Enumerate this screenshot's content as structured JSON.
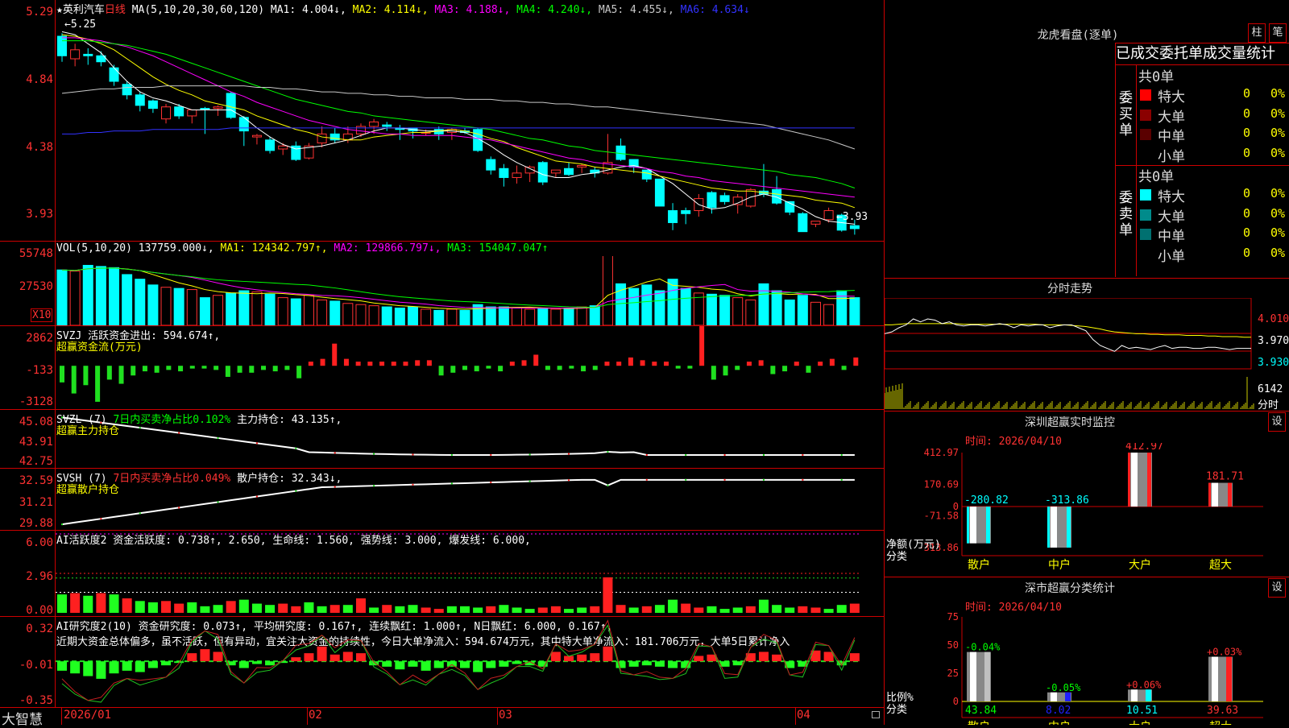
{
  "colors": {
    "up": "#ff3232",
    "down": "#00ffff",
    "ma1": "#ffffff",
    "ma2": "#ffff00",
    "ma3": "#ff00ff",
    "ma4": "#00ff00",
    "ma5": "#c8c8c8",
    "ma6": "#3232ff",
    "grid": "#cc0000"
  },
  "header": {
    "star": "★",
    "stock_name": "英利汽车",
    "period": "日线",
    "ma_params": "MA(5,10,20,30,60,120)",
    "ma1": "MA1: 4.004↓,",
    "ma2": "MA2: 4.114↓,",
    "ma3": "MA3: 4.188↓,",
    "ma4": "MA4: 4.240↓,",
    "ma5": "MA5: 4.455↓,",
    "ma6": "MA6: 4.634↓"
  },
  "price_panel": {
    "y_ticks": [
      "5.29",
      "4.84",
      "4.38",
      "3.93"
    ],
    "high_label": "←5.25",
    "low_label": "←3.93",
    "y_range": [
      3.9,
      5.4
    ]
  },
  "candles": [
    [
      5.25,
      5.12,
      5.27,
      5.08
    ],
    [
      5.1,
      5.16,
      5.2,
      5.05
    ],
    [
      5.13,
      5.12,
      5.17,
      5.06
    ],
    [
      5.12,
      5.08,
      5.15,
      5.05
    ],
    [
      5.04,
      4.95,
      5.06,
      4.92
    ],
    [
      4.93,
      4.86,
      4.95,
      4.83
    ],
    [
      4.86,
      4.79,
      4.88,
      4.75
    ],
    [
      4.82,
      4.77,
      4.83,
      4.74
    ],
    [
      4.7,
      4.78,
      4.8,
      4.67
    ],
    [
      4.78,
      4.72,
      4.8,
      4.7
    ],
    [
      4.72,
      4.76,
      4.76,
      4.67
    ],
    [
      4.77,
      4.76,
      4.78,
      4.6
    ],
    [
      4.77,
      4.78,
      4.79,
      4.72
    ],
    [
      4.87,
      4.71,
      4.88,
      4.7
    ],
    [
      4.71,
      4.62,
      4.72,
      4.52
    ],
    [
      4.58,
      4.59,
      4.6,
      4.53
    ],
    [
      4.56,
      4.49,
      4.58,
      4.47
    ],
    [
      4.5,
      4.52,
      4.54,
      4.46
    ],
    [
      4.52,
      4.43,
      4.55,
      4.42
    ],
    [
      4.44,
      4.52,
      4.54,
      4.43
    ],
    [
      4.54,
      4.6,
      4.65,
      4.51
    ],
    [
      4.6,
      4.56,
      4.64,
      4.54
    ],
    [
      4.56,
      4.6,
      4.65,
      4.54
    ],
    [
      4.6,
      4.65,
      4.67,
      4.58
    ],
    [
      4.65,
      4.68,
      4.7,
      4.6
    ],
    [
      4.66,
      4.65,
      4.68,
      4.62
    ],
    [
      4.64,
      4.63,
      4.66,
      4.56
    ],
    [
      4.64,
      4.62,
      4.64,
      4.57
    ],
    [
      4.61,
      4.61,
      4.63,
      4.59
    ],
    [
      4.63,
      4.6,
      4.65,
      4.56
    ],
    [
      4.61,
      4.63,
      4.64,
      4.56
    ],
    [
      4.62,
      4.61,
      4.64,
      4.6
    ],
    [
      4.63,
      4.49,
      4.64,
      4.48
    ],
    [
      4.43,
      4.36,
      4.45,
      4.33
    ],
    [
      4.37,
      4.31,
      4.4,
      4.25
    ],
    [
      4.31,
      4.34,
      4.39,
      4.27
    ],
    [
      4.34,
      4.38,
      4.39,
      4.28
    ],
    [
      4.41,
      4.28,
      4.42,
      4.26
    ],
    [
      4.34,
      4.36,
      4.36,
      4.31
    ],
    [
      4.37,
      4.33,
      4.41,
      4.32
    ],
    [
      4.38,
      4.39,
      4.4,
      4.34
    ],
    [
      4.36,
      4.34,
      4.38,
      4.31
    ],
    [
      4.34,
      4.41,
      4.6,
      4.33
    ],
    [
      4.52,
      4.43,
      4.57,
      4.42
    ],
    [
      4.43,
      4.38,
      4.43,
      4.34
    ],
    [
      4.36,
      4.3,
      4.36,
      4.28
    ],
    [
      4.3,
      4.12,
      4.3,
      4.12
    ],
    [
      4.09,
      4.01,
      4.14,
      3.96
    ],
    [
      4.09,
      4.07,
      4.11,
      4.0
    ],
    [
      4.09,
      4.17,
      4.2,
      4.05
    ],
    [
      4.21,
      4.11,
      4.22,
      4.07
    ],
    [
      4.19,
      4.15,
      4.21,
      4.13
    ],
    [
      4.13,
      4.18,
      4.2,
      4.07
    ],
    [
      4.12,
      4.23,
      4.24,
      4.11
    ],
    [
      4.22,
      4.2,
      4.4,
      4.18
    ],
    [
      4.23,
      4.14,
      4.32,
      4.13
    ],
    [
      4.15,
      4.08,
      4.15,
      4.06
    ],
    [
      4.07,
      3.95,
      4.08,
      3.95
    ],
    [
      4.0,
      4.02,
      4.02,
      3.98
    ],
    [
      4.03,
      4.09,
      4.11,
      4.01
    ],
    [
      4.06,
      3.96,
      4.07,
      3.95
    ],
    [
      3.99,
      3.97,
      4.03,
      3.93
    ]
  ],
  "ma_lines": {
    "ma1": [
      5.28,
      5.26,
      5.2,
      5.14,
      5.04,
      4.95,
      4.88,
      4.84,
      4.82,
      4.79,
      4.76,
      4.76,
      4.76,
      4.76,
      4.71,
      4.64,
      4.58,
      4.53,
      4.5,
      4.51,
      4.52,
      4.54,
      4.56,
      4.59,
      4.62,
      4.64,
      4.64,
      4.63,
      4.62,
      4.62,
      4.62,
      4.61,
      4.57,
      4.52,
      4.46,
      4.41,
      4.37,
      4.33,
      4.31,
      4.31,
      4.33,
      4.34,
      4.36,
      4.38,
      4.39,
      4.37,
      4.32,
      4.27,
      4.2,
      4.13,
      4.1,
      4.11,
      4.14,
      4.18,
      4.2,
      4.18,
      4.14,
      4.1,
      4.05,
      4.02,
      4.01,
      4.0
    ],
    "ma2": [
      5.26,
      5.25,
      5.23,
      5.2,
      5.16,
      5.1,
      5.04,
      4.98,
      4.93,
      4.89,
      4.86,
      4.82,
      4.8,
      4.78,
      4.76,
      4.72,
      4.69,
      4.66,
      4.63,
      4.61,
      4.58,
      4.57,
      4.56,
      4.56,
      4.58,
      4.59,
      4.6,
      4.61,
      4.61,
      4.62,
      4.63,
      4.62,
      4.6,
      4.57,
      4.55,
      4.51,
      4.48,
      4.45,
      4.42,
      4.41,
      4.4,
      4.38,
      4.37,
      4.36,
      4.35,
      4.34,
      4.32,
      4.3,
      4.28,
      4.26,
      4.24,
      4.23,
      4.22,
      4.22,
      4.21,
      4.2,
      4.19,
      4.18,
      4.16,
      4.15,
      4.14,
      4.11
    ],
    "ma3": [
      5.24,
      5.24,
      5.23,
      5.22,
      5.2,
      5.18,
      5.15,
      5.12,
      5.08,
      5.04,
      5.0,
      4.96,
      4.92,
      4.88,
      4.85,
      4.81,
      4.78,
      4.75,
      4.72,
      4.69,
      4.67,
      4.65,
      4.63,
      4.62,
      4.61,
      4.6,
      4.6,
      4.59,
      4.59,
      4.59,
      4.59,
      4.58,
      4.57,
      4.56,
      4.54,
      4.52,
      4.5,
      4.48,
      4.46,
      4.44,
      4.43,
      4.41,
      4.4,
      4.39,
      4.38,
      4.37,
      4.35,
      4.34,
      4.32,
      4.31,
      4.29,
      4.28,
      4.27,
      4.26,
      4.25,
      4.24,
      4.23,
      4.22,
      4.21,
      4.2,
      4.19,
      4.18
    ],
    "ma4": [
      5.22,
      5.22,
      5.22,
      5.21,
      5.2,
      5.19,
      5.17,
      5.15,
      5.13,
      5.1,
      5.07,
      5.04,
      5.01,
      4.98,
      4.95,
      4.92,
      4.89,
      4.86,
      4.83,
      4.81,
      4.79,
      4.77,
      4.75,
      4.74,
      4.72,
      4.71,
      4.7,
      4.69,
      4.68,
      4.67,
      4.66,
      4.65,
      4.64,
      4.63,
      4.61,
      4.59,
      4.57,
      4.56,
      4.54,
      4.52,
      4.51,
      4.49,
      4.48,
      4.47,
      4.46,
      4.45,
      4.44,
      4.43,
      4.42,
      4.41,
      4.4,
      4.39,
      4.38,
      4.37,
      4.36,
      4.35,
      4.33,
      4.32,
      4.31,
      4.29,
      4.27,
      4.24
    ],
    "ma5": [
      4.87,
      4.88,
      4.89,
      4.9,
      4.9,
      4.91,
      4.91,
      4.91,
      4.92,
      4.92,
      4.92,
      4.92,
      4.92,
      4.92,
      4.92,
      4.91,
      4.91,
      4.9,
      4.9,
      4.89,
      4.88,
      4.88,
      4.87,
      4.87,
      4.86,
      4.86,
      4.85,
      4.85,
      4.84,
      4.84,
      4.84,
      4.83,
      4.83,
      4.83,
      4.82,
      4.82,
      4.81,
      4.81,
      4.8,
      4.8,
      4.79,
      4.78,
      4.78,
      4.77,
      4.76,
      4.75,
      4.74,
      4.73,
      4.72,
      4.71,
      4.7,
      4.69,
      4.68,
      4.67,
      4.66,
      4.64,
      4.62,
      4.6,
      4.58,
      4.56,
      4.53,
      4.5
    ],
    "ma6": [
      4.6,
      4.6,
      4.61,
      4.61,
      4.62,
      4.62,
      4.62,
      4.63,
      4.63,
      4.63,
      4.63,
      4.63,
      4.63,
      4.64,
      4.64,
      4.64,
      4.64,
      4.64,
      4.64,
      4.64,
      4.64,
      4.64,
      4.64,
      4.64,
      4.64,
      4.64,
      4.64,
      4.64,
      4.64,
      4.64,
      4.64,
      4.64,
      4.64,
      4.64,
      4.64,
      4.64,
      4.64,
      4.64,
      4.64,
      4.64,
      4.64,
      4.64,
      4.64,
      4.64,
      4.64,
      4.64,
      4.64,
      4.64,
      4.64,
      4.64,
      4.64,
      4.64,
      4.64,
      4.64,
      4.64,
      4.64,
      4.64,
      4.64,
      4.64,
      4.64,
      4.64,
      4.64
    ]
  },
  "vol_panel": {
    "header_param": "VOL(5,10,20)",
    "header_val": "137759.000↓,",
    "ma1": "MA1: 124342.797↑,",
    "ma2": "MA2: 129866.797↓,",
    "ma3": "MA3: 154047.047↑",
    "y_ticks": [
      "55748",
      "27530"
    ],
    "unit": "X10",
    "y_max": 60000,
    "values": [
      48000,
      47000,
      52000,
      51000,
      50000,
      44000,
      40000,
      35000,
      33000,
      32000,
      31000,
      24000,
      26000,
      28000,
      30000,
      29000,
      27000,
      24000,
      23000,
      26000,
      22000,
      21000,
      19000,
      18000,
      17000,
      16000,
      15000,
      16000,
      14000,
      13000,
      14000,
      13000,
      18000,
      16000,
      16000,
      15000,
      14000,
      15000,
      14000,
      15000,
      16000,
      17000,
      68000,
      36000,
      32000,
      35000,
      30000,
      40000,
      32000,
      28000,
      27000,
      26000,
      24000,
      22000,
      36000,
      30000,
      22000,
      26000,
      20000,
      18000,
      30000,
      24000
    ]
  },
  "svzj_panel": {
    "line1": "SVZJ  活跃资金进出: 594.674↑,",
    "line2": "超赢资金流(万元)",
    "y_ticks": [
      "2862",
      "-133",
      "-3128"
    ],
    "y_range": [
      -3128,
      2862
    ],
    "values": [
      -1200,
      -2000,
      -1400,
      -2600,
      -1000,
      -1300,
      -700,
      -400,
      -500,
      -300,
      -400,
      -200,
      -200,
      -300,
      -800,
      -500,
      -500,
      -300,
      -400,
      -300,
      -900,
      300,
      500,
      1600,
      500,
      300,
      300,
      300,
      300,
      300,
      400,
      400,
      -700,
      -500,
      -300,
      -400,
      -200,
      -400,
      300,
      400,
      800,
      -300,
      -300,
      -200,
      -400,
      -300,
      300,
      300,
      600,
      400,
      300,
      300,
      -200,
      -200,
      3000,
      -1000,
      -700,
      -300,
      300,
      400,
      -600,
      -400,
      300,
      -500,
      300,
      500,
      -300,
      600
    ]
  },
  "svzl_panel": {
    "line1_a": "SVZL (7)",
    "line1_b": "7日内买卖净占比0.102%",
    "line1_c": "主力持仓: 43.135↑,",
    "line2": "超赢主力持仓",
    "y_ticks": [
      "45.08",
      "43.91",
      "42.75"
    ],
    "y_range": [
      42.6,
      45.3
    ]
  },
  "svsh_panel": {
    "line1_a": "SVSH (7)",
    "line1_b": "7日内买卖净占比0.049%",
    "line1_c": "散户持仓: 32.343↓,",
    "line2": "超赢散户持仓",
    "y_ticks": [
      "32.59",
      "31.21",
      "29.88"
    ],
    "y_range": [
      29.7,
      33.0
    ]
  },
  "ai_active_panel": {
    "line": "AI活跃度2 资金活跃度: 0.738↑, 2.650, 生命线: 1.560, 强势线: 3.000, 爆发线: 6.000,",
    "y_ticks": [
      "6.00",
      "2.96",
      "0.00"
    ],
    "y_max": 6.0,
    "values": [
      1.4,
      1.5,
      1.3,
      1.5,
      1.4,
      1.1,
      0.9,
      0.8,
      0.9,
      0.7,
      0.8,
      0.5,
      0.6,
      0.9,
      1.0,
      0.7,
      0.6,
      0.7,
      0.5,
      0.8,
      0.5,
      0.6,
      0.6,
      1.1,
      0.4,
      0.6,
      0.5,
      0.6,
      0.4,
      0.3,
      0.5,
      0.5,
      0.4,
      0.5,
      0.6,
      0.4,
      0.3,
      0.4,
      0.5,
      0.3,
      0.4,
      0.5,
      2.7,
      0.6,
      0.4,
      0.5,
      0.6,
      1.0,
      0.7,
      0.4,
      0.5,
      0.3,
      0.4,
      0.5,
      1.0,
      0.6,
      0.4,
      0.5,
      0.4,
      0.3,
      0.6,
      0.7
    ]
  },
  "ai_research_panel": {
    "line": "AI研究度2(10) 资金研究度: 0.073↑, 平均研究度: 0.167↑, 连续飘红: 1.000↑, N日飘红: 6.000, 0.167↑,",
    "comment": "近期大资金总体偏多，虽不活跃，但有异动，宜关注大资金的持续性，今日大单净流入：594.674万元，其中特大单净流入：181.706万元，大单5日累计净入",
    "y_ticks": [
      "0.32",
      "-0.01",
      "-0.35"
    ],
    "y_range": [
      -0.35,
      0.32
    ],
    "values": [
      -0.08,
      -0.1,
      -0.12,
      -0.14,
      -0.1,
      -0.08,
      -0.09,
      -0.06,
      -0.04,
      -0.02,
      0.05,
      0.08,
      0.06,
      -0.04,
      -0.06,
      -0.03,
      -0.04,
      -0.02,
      0.02,
      0.05,
      0.1,
      0.04,
      0.06,
      0.05,
      -0.04,
      -0.05,
      -0.07,
      -0.05,
      -0.08,
      -0.06,
      -0.05,
      -0.06,
      -0.09,
      -0.06,
      -0.05,
      -0.03,
      -0.04,
      -0.05,
      0.06,
      0.03,
      0.04,
      0.05,
      0.1,
      -0.06,
      -0.05,
      -0.04,
      -0.05,
      -0.06,
      -0.06,
      0.03,
      0.04,
      -0.05,
      -0.04,
      0.05,
      0.06,
      0.04,
      -0.06,
      -0.05,
      0.07,
      0.06,
      -0.04,
      0.05
    ]
  },
  "x_axis": {
    "labels": [
      "2026/01",
      "02",
      "03",
      "04"
    ]
  },
  "bottom": {
    "brand": "大智慧"
  },
  "dragon": {
    "title": "龙虎看盘(逐单)",
    "btn_bar": "柱",
    "btn_detail": "笔",
    "header": "已成交委托单成交量统计",
    "buy_total": "共0单",
    "sell_total": "共0单",
    "buy_label": [
      "委",
      "买",
      "单"
    ],
    "sell_label": [
      "委",
      "卖",
      "单"
    ],
    "buy_rows": [
      {
        "name": "特大",
        "count": "0",
        "pct": "0%",
        "color": "#ff0000"
      },
      {
        "name": "大单",
        "count": "0",
        "pct": "0%",
        "color": "#8b0000"
      },
      {
        "name": "中单",
        "count": "0",
        "pct": "0%",
        "color": "#5a0000"
      },
      {
        "name": "小单",
        "count": "0",
        "pct": "0%",
        "color": "#000000"
      }
    ],
    "sell_rows": [
      {
        "name": "特大",
        "count": "0",
        "pct": "0%",
        "color": "#00ffff"
      },
      {
        "name": "大单",
        "count": "0",
        "pct": "0%",
        "color": "#008b8b"
      },
      {
        "name": "中单",
        "count": "0",
        "pct": "0%",
        "color": "#007070"
      },
      {
        "name": "小单",
        "count": "0",
        "pct": "0%",
        "color": "#000000"
      }
    ]
  },
  "intraday": {
    "title": "分时走势",
    "prices": [
      "4.010",
      "3.970",
      "3.930"
    ],
    "vol_val": "6142",
    "vol_unit": "分时",
    "price_series": [
      3.995,
      3.998,
      4.005,
      4.01,
      4.02,
      4.015,
      4.02,
      4.018,
      4.012,
      4.015,
      4.01,
      4.008,
      4.01,
      4.01,
      4.008,
      4.01,
      4.012,
      4.01,
      4.005,
      4.01,
      4.008,
      4.01,
      4.01,
      4.005,
      4.008,
      4.01,
      4.01,
      4.005,
      4.0,
      3.985,
      3.975,
      3.97,
      3.965,
      3.975,
      3.97,
      3.972,
      3.97,
      3.968,
      3.972,
      3.975,
      3.97,
      3.972,
      3.972,
      3.97,
      3.97,
      3.972,
      3.972,
      3.97,
      3.968,
      3.97,
      3.97,
      3.97
    ],
    "avg_series": [
      4.01,
      4.01,
      4.011,
      4.012,
      4.012,
      4.012,
      4.012,
      4.012,
      4.012,
      4.012,
      4.012,
      4.011,
      4.011,
      4.011,
      4.011,
      4.011,
      4.011,
      4.011,
      4.011,
      4.011,
      4.011,
      4.011,
      4.01,
      4.01,
      4.01,
      4.01,
      4.009,
      4.008,
      4.007,
      4.005,
      4.003,
      4.0,
      3.998,
      3.997,
      3.996,
      3.995,
      3.995,
      3.994,
      3.994,
      3.993,
      3.993,
      3.993,
      3.992,
      3.992,
      3.992,
      3.991,
      3.991,
      3.99,
      3.99,
      3.99,
      3.989,
      3.989
    ]
  },
  "sz_monitor": {
    "title": "深圳超赢实时监控",
    "btn": "设",
    "time": "时间: 2026/04/10",
    "y_ticks": [
      "412.97",
      "170.69",
      "0",
      "-71.58",
      "-313.86"
    ],
    "axis_title_1": "净额(万元)",
    "axis_title_2": "分类",
    "bars": [
      {
        "cat": "散户",
        "value": -280.82,
        "label": "-280.82"
      },
      {
        "cat": "中户",
        "value": -313.86,
        "label": "-313.86"
      },
      {
        "cat": "大户",
        "value": 412.97,
        "label": "412.97"
      },
      {
        "cat": "超大",
        "value": 181.71,
        "label": "181.71"
      }
    ]
  },
  "sz_class": {
    "title": "深市超赢分类统计",
    "btn": "设",
    "time": "时间: 2026/04/10",
    "y_ticks": [
      "75",
      "50",
      "25",
      "0"
    ],
    "axis_title_1": "比例%",
    "axis_title_2": "分类",
    "bars": [
      {
        "cat": "散户",
        "value": 43.84,
        "label": "43.84",
        "delta": "-0.04%",
        "color": "#c0c0c0"
      },
      {
        "cat": "中户",
        "value": 8.02,
        "label": "8.02",
        "delta": "-0.05%",
        "color": "#2020ff"
      },
      {
        "cat": "大户",
        "value": 10.51,
        "label": "10.51",
        "delta": "+0.06%",
        "color": "#00ffff"
      },
      {
        "cat": "超大",
        "value": 39.63,
        "label": "39.63",
        "delta": "+0.03%",
        "color": "#ff2020"
      }
    ]
  }
}
